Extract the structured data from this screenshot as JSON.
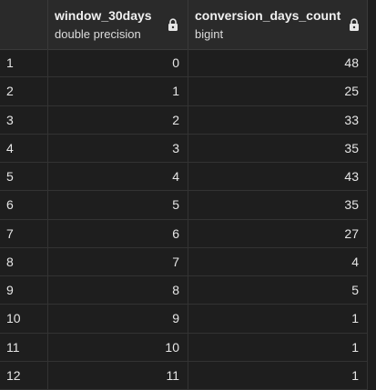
{
  "columns": [
    {
      "name": "window_30days",
      "type": "double precision",
      "locked": true
    },
    {
      "name": "conversion_days_count",
      "type": "bigint",
      "locked": true
    }
  ],
  "rows": [
    {
      "idx": "1",
      "window": "0",
      "count": "48"
    },
    {
      "idx": "2",
      "window": "1",
      "count": "25"
    },
    {
      "idx": "3",
      "window": "2",
      "count": "33"
    },
    {
      "idx": "4",
      "window": "3",
      "count": "35"
    },
    {
      "idx": "5",
      "window": "4",
      "count": "43"
    },
    {
      "idx": "6",
      "window": "5",
      "count": "35"
    },
    {
      "idx": "7",
      "window": "6",
      "count": "27"
    },
    {
      "idx": "8",
      "window": "7",
      "count": "4"
    },
    {
      "idx": "9",
      "window": "8",
      "count": "5"
    },
    {
      "idx": "10",
      "window": "9",
      "count": "1"
    },
    {
      "idx": "11",
      "window": "10",
      "count": "1"
    },
    {
      "idx": "12",
      "window": "11",
      "count": "1"
    }
  ],
  "icons": {
    "lock": "lock-icon"
  },
  "colors": {
    "background": "#1e1e1e",
    "header": "#2a2a2a",
    "text": "#e6e6e6"
  }
}
